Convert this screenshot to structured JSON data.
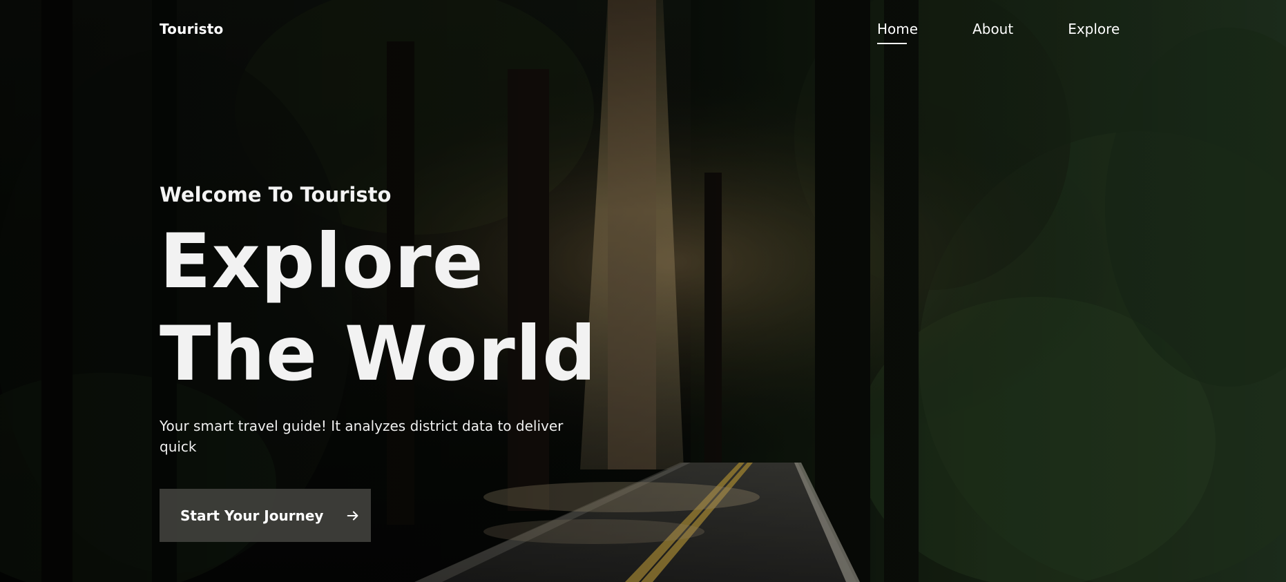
{
  "brand": {
    "name": "Touristo"
  },
  "nav": {
    "items": [
      {
        "label": "Home",
        "active": true
      },
      {
        "label": "About",
        "active": false
      },
      {
        "label": "Explore",
        "active": false
      }
    ]
  },
  "hero": {
    "welcome": "Welcome To Touristo",
    "headline_line1": "Explore",
    "headline_line2": "The World",
    "description": "Your smart travel guide! It analyzes district data to deliver quick",
    "cta_label": "Start Your Journey",
    "cta_icon": "arrow-right-icon",
    "background": "forest-road-with-light-beam"
  },
  "colors": {
    "text": "#ffffff",
    "button_bg": "#40403c",
    "forest_dark": "#0b0f0b",
    "light_beam": "#c9a56a",
    "road": "#3a3a3a",
    "road_lines": "#d8b44a"
  }
}
